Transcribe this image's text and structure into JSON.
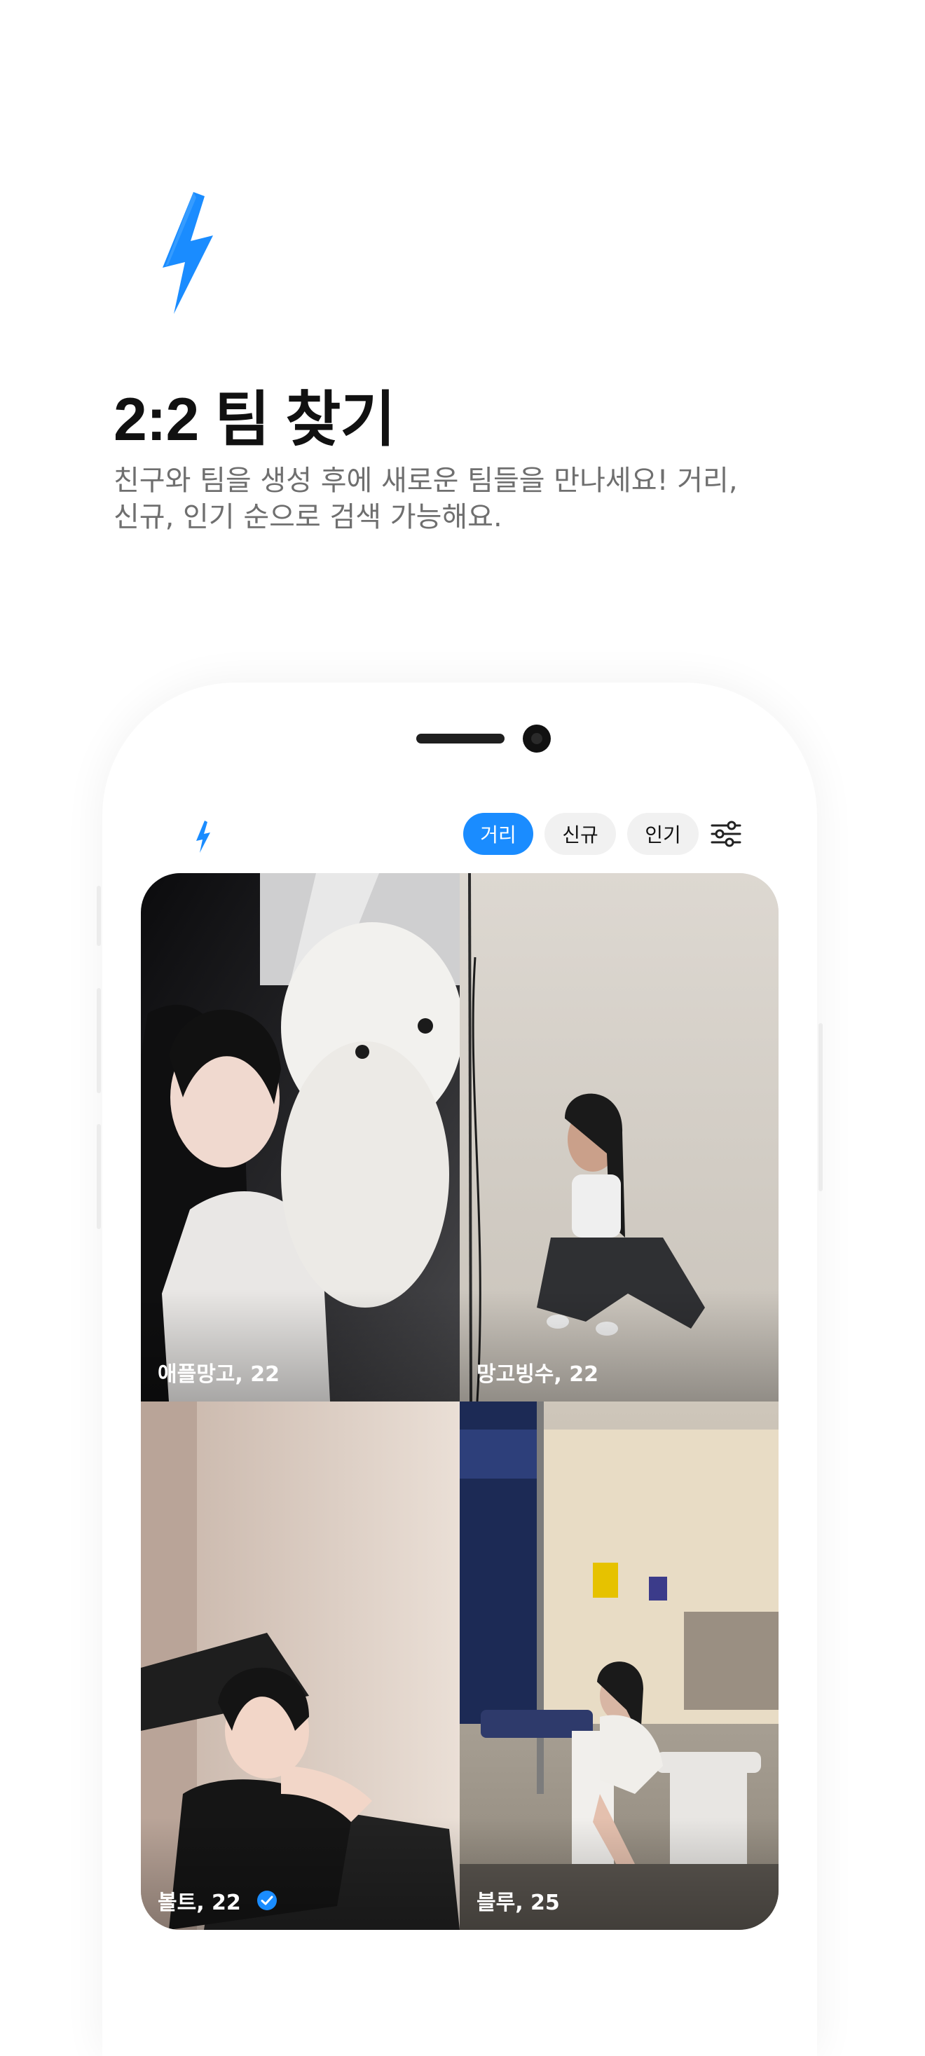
{
  "hero": {
    "icon": "lightning-bolt-icon",
    "title": "2:2 팀 찾기",
    "subtitle_line1": "친구와 팀을 생성 후에 새로운 팀들을 만나세요! 거리,",
    "subtitle_line2": "신규, 인기 순으로 검색 가능해요."
  },
  "app": {
    "logo_icon": "lightning-bolt-icon",
    "sort_chips": [
      {
        "label": "거리",
        "active": true
      },
      {
        "label": "신규",
        "active": false
      },
      {
        "label": "인기",
        "active": false
      }
    ],
    "filter_icon": "sliders-icon",
    "profiles": [
      {
        "caption": "애플망고, 22",
        "verified": false
      },
      {
        "caption": "망고빙수, 22",
        "verified": false
      },
      {
        "caption": "볼트, 22",
        "verified": true
      },
      {
        "caption": "블루, 25",
        "verified": false
      }
    ]
  },
  "colors": {
    "accent": "#1a8cff",
    "title": "#111111",
    "subtitle": "#6f6f6f",
    "chip_inactive": "#f1f1f1"
  }
}
